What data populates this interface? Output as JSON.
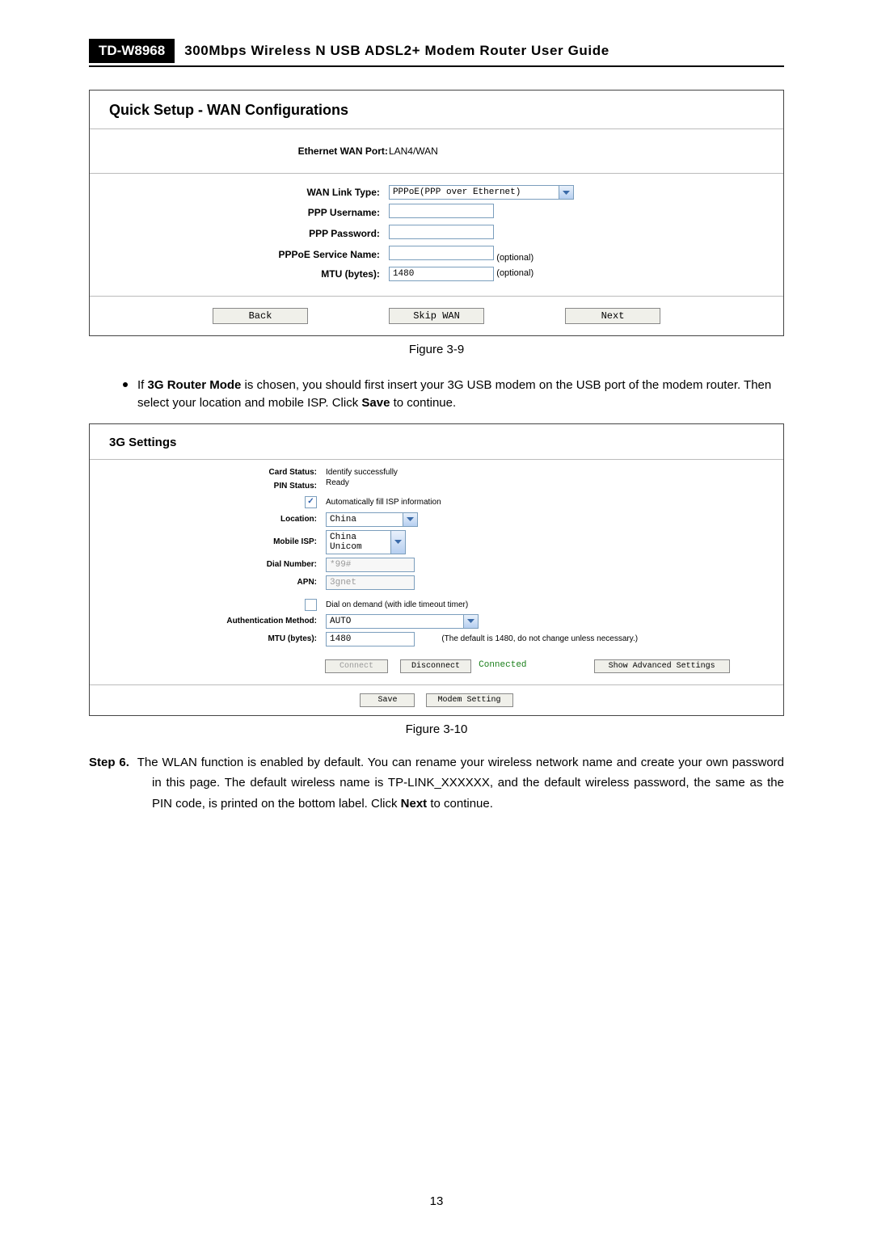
{
  "header": {
    "model": "TD-W8968",
    "doc_title": "300Mbps Wireless N USB ADSL2+ Modem Router User Guide"
  },
  "wan_panel": {
    "title": "Quick Setup - WAN Configurations",
    "ewan_port_label": "Ethernet WAN Port:",
    "ewan_port_value": "LAN4/WAN",
    "wan_link_label": "WAN Link Type:",
    "wan_link_value": "PPPoE(PPP over Ethernet)",
    "ppp_user_label": "PPP Username:",
    "ppp_user_value": "",
    "ppp_pass_label": "PPP Password:",
    "ppp_pass_value": "",
    "svc_name_label": "PPPoE Service Name:",
    "svc_name_value": "",
    "svc_name_hint": "(optional)",
    "mtu_label": "MTU (bytes):",
    "mtu_value": "1480",
    "mtu_hint": "(optional)",
    "back_btn": "Back",
    "skip_btn": "Skip WAN",
    "next_btn": "Next"
  },
  "fig9_caption": "Figure 3-9",
  "bullet_3g": "If 3G Router Mode is chosen, you should first insert your 3G USB modem on the USB port of the modem router. Then select your location and mobile ISP. Click Save to continue.",
  "bullet_3g_bold": "3G Router Mode",
  "bullet_3g_bold2": "Save",
  "g3_panel": {
    "title": "3G Settings",
    "card_status_label": "Card Status:",
    "card_status_value": "Identify successfully",
    "pin_status_label": "PIN Status:",
    "pin_status_value": "Ready",
    "auto_fill_label": "Automatically fill ISP information",
    "location_label": "Location:",
    "location_value": "China",
    "mobile_isp_label": "Mobile ISP:",
    "mobile_isp_value": "China Unicom",
    "dial_label": "Dial Number:",
    "dial_value": "*99#",
    "apn_label": "APN:",
    "apn_value": "3gnet",
    "dial_demand_label": "Dial on demand (with idle timeout timer)",
    "auth_label": "Authentication Method:",
    "auth_value": "AUTO",
    "mtu_label": "MTU (bytes):",
    "mtu_value": "1480",
    "mtu_hint": "(The default is 1480, do not change unless necessary.)",
    "conn_btn": "Connect",
    "disc_btn": "Disconnect",
    "conn_status": "Connected",
    "adv_btn": "Show Advanced Settings",
    "save_btn": "Save",
    "modem_btn": "Modem Setting"
  },
  "fig10_caption": "Figure 3-10",
  "step6_label": "Step 6.",
  "step6_text": "The WLAN function is enabled by default. You can rename your wireless network name and create your own password in this page. The default wireless name is TP-LINK_XXXXXX, and the default wireless password, the same as the PIN code, is printed on the bottom label. Click Next to continue.",
  "step6_bold": "Next",
  "page_number": "13"
}
